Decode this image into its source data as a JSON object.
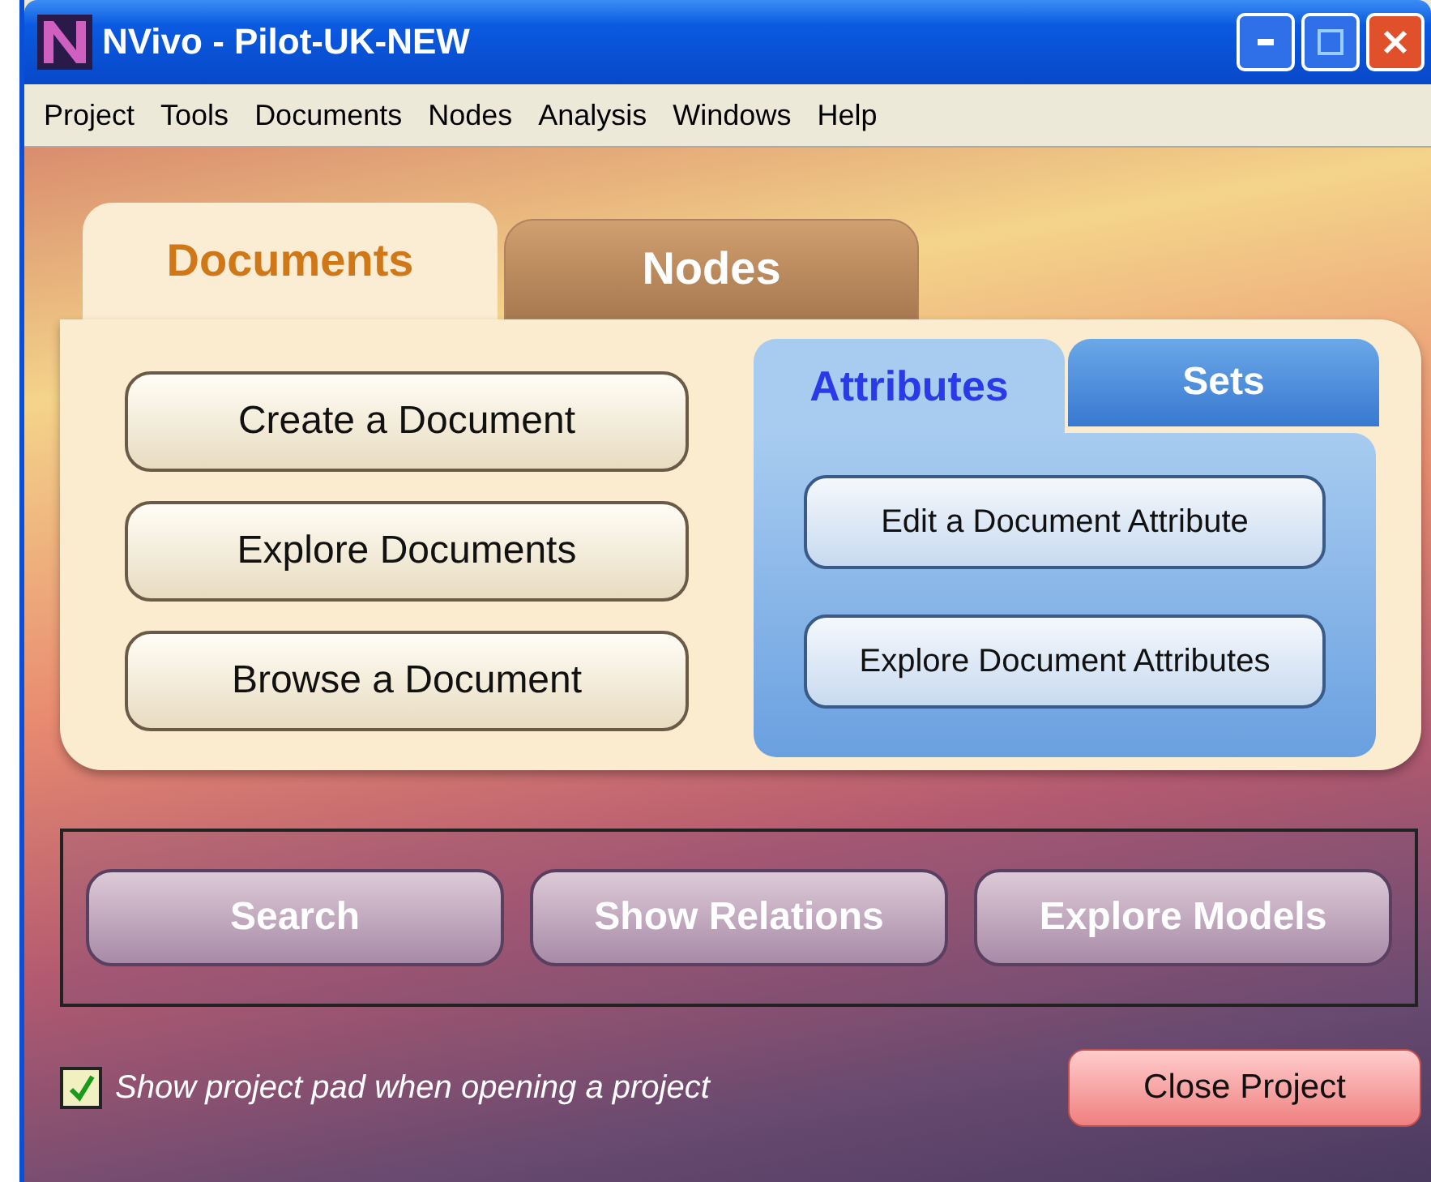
{
  "window": {
    "title": "NVivo - Pilot-UK-NEW"
  },
  "menu": [
    "Project",
    "Tools",
    "Documents",
    "Nodes",
    "Analysis",
    "Windows",
    "Help"
  ],
  "main_tabs": [
    {
      "label": "Documents",
      "selected": true
    },
    {
      "label": "Nodes",
      "selected": false
    }
  ],
  "document_actions": [
    "Create a Document",
    "Explore Documents",
    "Browse a Document"
  ],
  "sub_tabs": [
    {
      "label": "Attributes",
      "selected": true
    },
    {
      "label": "Sets",
      "selected": false
    }
  ],
  "attribute_actions": [
    "Edit a Document Attribute",
    "Explore Document Attributes"
  ],
  "tools": [
    "Search",
    "Show Relations",
    "Explore Models"
  ],
  "show_pad": {
    "label": "Show project pad when opening a project",
    "checked": true
  },
  "close_button": "Close Project"
}
